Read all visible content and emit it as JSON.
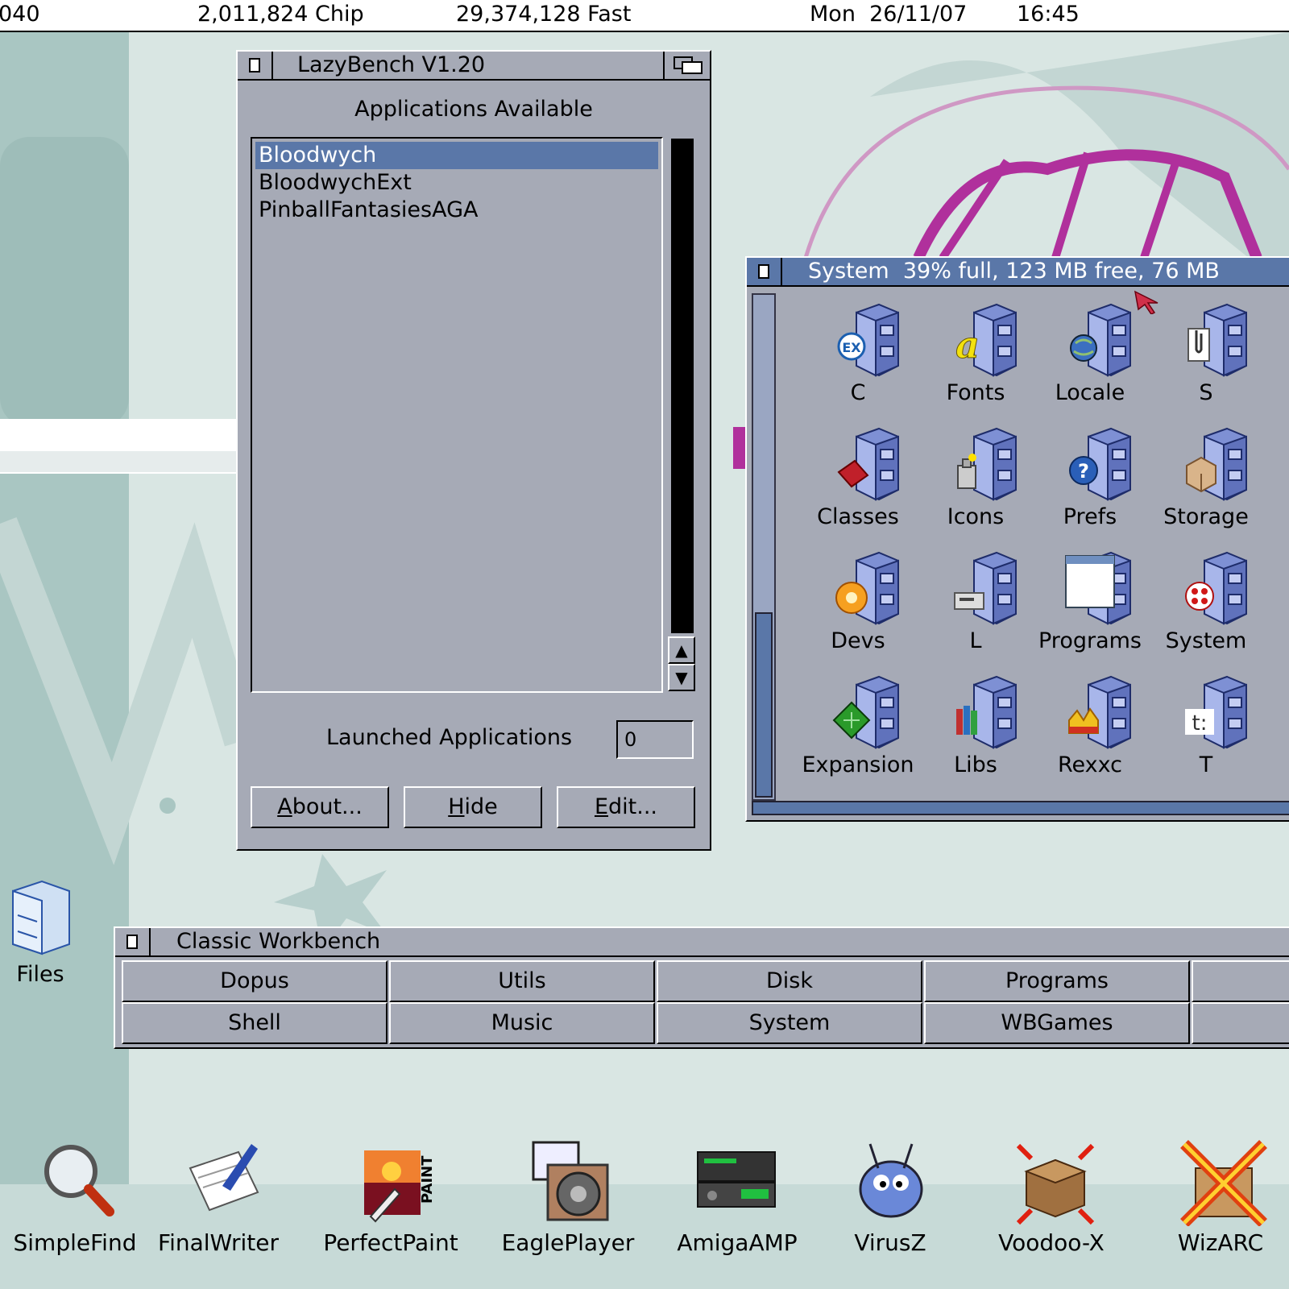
{
  "screen_bar": {
    "cpu": "040",
    "chip": "2,011,824 Chip",
    "fast": "29,374,128 Fast",
    "date": "Mon  26/11/07",
    "time": "16:45"
  },
  "lazybench": {
    "title": "LazyBench V1.20",
    "heading": "Applications Available",
    "apps": [
      "Bloodwych",
      "BloodwychExt",
      "PinballFantasiesAGA"
    ],
    "selected_index": 0,
    "launched_label": "Launched Applications",
    "launched_count": "0",
    "buttons": {
      "about": {
        "accel": "A",
        "rest": "bout..."
      },
      "hide": {
        "accel": "H",
        "rest": "ide"
      },
      "edit": {
        "accel": "E",
        "rest": "dit..."
      }
    }
  },
  "system_drawer": {
    "title": "System  39% full, 123 MB free, 76 MB",
    "items": [
      {
        "label": "C",
        "icon": "ex-drawer-icon"
      },
      {
        "label": "Fonts",
        "icon": "fonts-drawer-icon"
      },
      {
        "label": "Locale",
        "icon": "locale-drawer-icon"
      },
      {
        "label": "S",
        "icon": "s-drawer-icon"
      },
      {
        "label": "Classes",
        "icon": "classes-drawer-icon"
      },
      {
        "label": "Icons",
        "icon": "icons-drawer-icon"
      },
      {
        "label": "Prefs",
        "icon": "prefs-drawer-icon"
      },
      {
        "label": "Storage",
        "icon": "storage-drawer-icon"
      },
      {
        "label": "Devs",
        "icon": "devs-drawer-icon"
      },
      {
        "label": "L",
        "icon": "l-drawer-icon"
      },
      {
        "label": "Programs",
        "icon": "programs-drawer-icon"
      },
      {
        "label": "System",
        "icon": "system-drawer-icon"
      },
      {
        "label": "Expansion",
        "icon": "expansion-drawer-icon"
      },
      {
        "label": "Libs",
        "icon": "libs-drawer-icon"
      },
      {
        "label": "Rexxc",
        "icon": "rexxc-drawer-icon"
      },
      {
        "label": "T",
        "icon": "t-drawer-icon"
      }
    ]
  },
  "desktop": {
    "files_label": "Files"
  },
  "classic_workbench": {
    "title": "Classic Workbench",
    "buttons": [
      "Dopus",
      "Utils",
      "Disk",
      "Programs",
      "Shell",
      "Music",
      "System",
      "WBGames"
    ]
  },
  "dock": [
    {
      "label": "SimpleFind",
      "icon": "magnifier-icon"
    },
    {
      "label": "FinalWriter",
      "icon": "pen-paper-icon"
    },
    {
      "label": "PerfectPaint",
      "icon": "paint-icon"
    },
    {
      "label": "EaglePlayer",
      "icon": "speaker-icon"
    },
    {
      "label": "AmigaAMP",
      "icon": "amp-icon"
    },
    {
      "label": "VirusZ",
      "icon": "bug-icon"
    },
    {
      "label": "Voodoo-X",
      "icon": "box-arrows-icon"
    },
    {
      "label": "WizARC",
      "icon": "archive-icon"
    }
  ],
  "colors": {
    "window_bg": "#a6aab6",
    "active_title": "#5a77a8",
    "selection": "#5a77a8",
    "desktop": "#d6e3e0"
  }
}
